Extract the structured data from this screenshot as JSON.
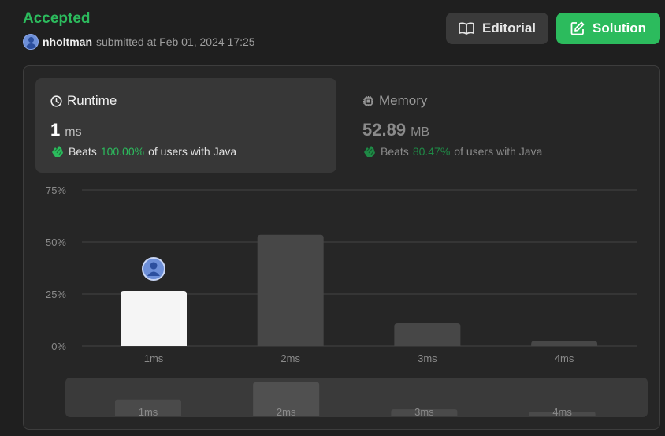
{
  "status": "Accepted",
  "submitter": {
    "username": "nholtman",
    "submitted_text": "submitted at Feb 01, 2024 17:25"
  },
  "buttons": {
    "editorial": "Editorial",
    "solution": "Solution"
  },
  "runtime": {
    "title": "Runtime",
    "value": "1",
    "unit": "ms",
    "beats_prefix": "Beats",
    "beats_pct": "100.00%",
    "beats_suffix": "of users with Java"
  },
  "memory": {
    "title": "Memory",
    "value": "52.89",
    "unit": "MB",
    "beats_prefix": "Beats",
    "beats_pct": "80.47%",
    "beats_suffix": "of users with Java"
  },
  "colors": {
    "accent_green": "#2cbb5d",
    "bar_selected": "#f5f5f5",
    "bar_default": "#474747"
  },
  "chart_data": {
    "type": "bar",
    "categories": [
      "1ms",
      "2ms",
      "3ms",
      "4ms"
    ],
    "values": [
      26.5,
      53.5,
      11,
      2.5
    ],
    "selected_index": 0,
    "ylim": [
      0,
      75
    ],
    "yticks": [
      "0%",
      "25%",
      "50%",
      "75%"
    ],
    "ytick_values": [
      0,
      25,
      50,
      75
    ],
    "grid": true
  },
  "minimap": {
    "labels": [
      "1ms",
      "2ms",
      "3ms",
      "4ms"
    ]
  }
}
